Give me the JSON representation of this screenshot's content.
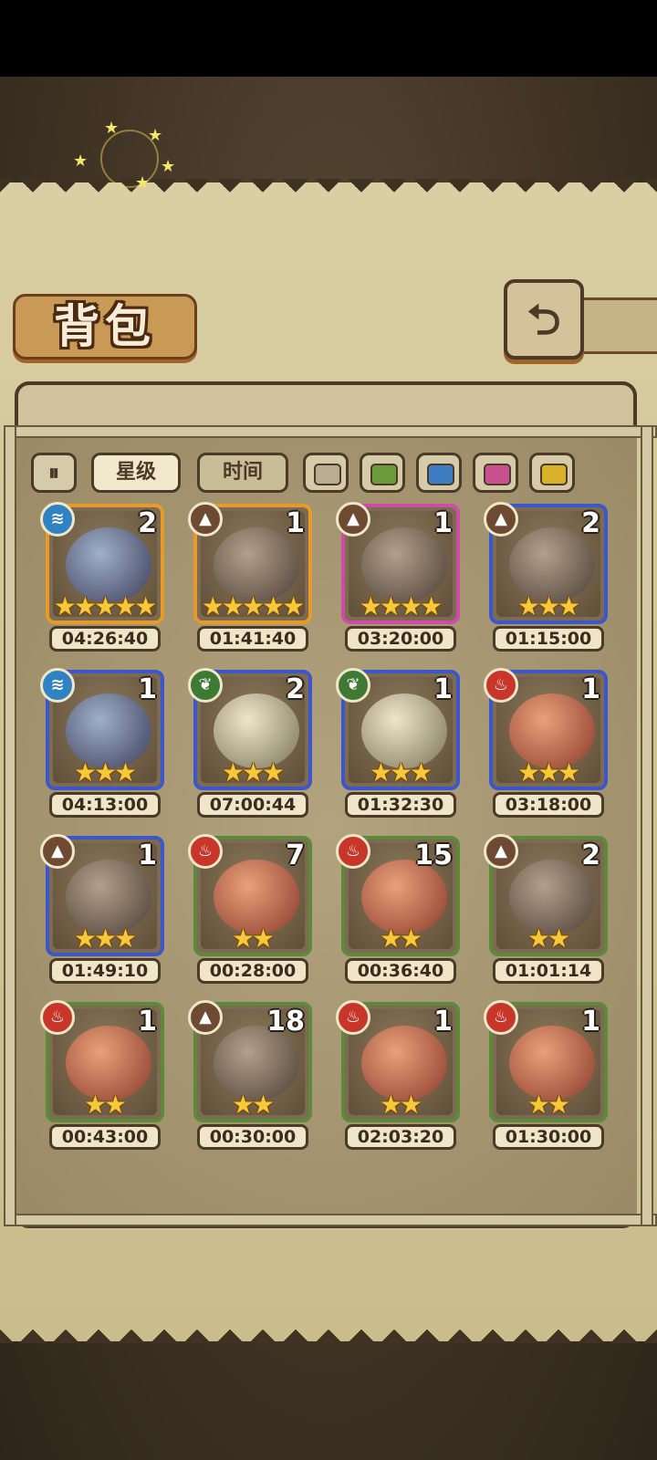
{
  "title": "背包",
  "back_icon": "back-arrow-icon",
  "toolbar": {
    "sort_icon": "sort-toggle-icon",
    "sort_label": "⏸",
    "star_label": "星级",
    "time_label": "时间",
    "color_filters": [
      {
        "name": "gray",
        "color": "#b8ad91"
      },
      {
        "name": "green",
        "color": "#6a9a3a"
      },
      {
        "name": "blue",
        "color": "#3d7ec2"
      },
      {
        "name": "pink",
        "color": "#c8508e"
      },
      {
        "name": "yellow",
        "color": "#d9b02a"
      }
    ]
  },
  "items": [
    {
      "element": "water",
      "count": "2",
      "stars": 5,
      "time": "04:26:40",
      "rarity": "gold"
    },
    {
      "element": "earth",
      "count": "1",
      "stars": 5,
      "time": "01:41:40",
      "rarity": "gold"
    },
    {
      "element": "earth",
      "count": "1",
      "stars": 4,
      "time": "03:20:00",
      "rarity": "pink"
    },
    {
      "element": "earth",
      "count": "2",
      "stars": 3,
      "time": "01:15:00",
      "rarity": "blue"
    },
    {
      "element": "water",
      "count": "1",
      "stars": 3,
      "time": "04:13:00",
      "rarity": "blue"
    },
    {
      "element": "grass",
      "count": "2",
      "stars": 3,
      "time": "07:00:44",
      "rarity": "blue"
    },
    {
      "element": "grass",
      "count": "1",
      "stars": 3,
      "time": "01:32:30",
      "rarity": "blue"
    },
    {
      "element": "fire",
      "count": "1",
      "stars": 3,
      "time": "03:18:00",
      "rarity": "blue"
    },
    {
      "element": "earth",
      "count": "1",
      "stars": 3,
      "time": "01:49:10",
      "rarity": "blue"
    },
    {
      "element": "fire",
      "count": "7",
      "stars": 2,
      "time": "00:28:00",
      "rarity": "green"
    },
    {
      "element": "fire",
      "count": "15",
      "stars": 2,
      "time": "00:36:40",
      "rarity": "green"
    },
    {
      "element": "earth",
      "count": "2",
      "stars": 2,
      "time": "01:01:14",
      "rarity": "green"
    },
    {
      "element": "fire",
      "count": "1",
      "stars": 2,
      "time": "00:43:00",
      "rarity": "green"
    },
    {
      "element": "earth",
      "count": "18",
      "stars": 2,
      "time": "00:30:00",
      "rarity": "green"
    },
    {
      "element": "fire",
      "count": "1",
      "stars": 2,
      "time": "02:03:20",
      "rarity": "green"
    },
    {
      "element": "fire",
      "count": "1",
      "stars": 2,
      "time": "01:30:00",
      "rarity": "green"
    }
  ],
  "rarity_colors": {
    "gold": "#e59a2a",
    "pink": "#d04aa8",
    "blue": "#3b57c9",
    "green": "#5c8a3a"
  },
  "element_colors": {
    "water": "#2f82c4",
    "earth": "#6e4a32",
    "grass": "#3f7a34",
    "fire": "#c8362a"
  }
}
